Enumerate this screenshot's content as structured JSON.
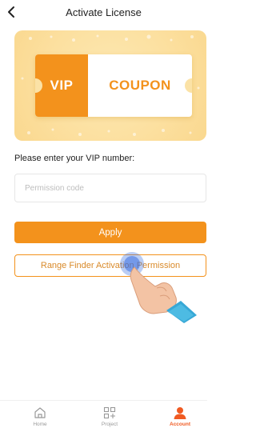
{
  "header": {
    "title": "Activate License"
  },
  "banner": {
    "vip": "VIP",
    "coupon": "COUPON"
  },
  "form": {
    "prompt": "Please enter your VIP number:",
    "placeholder": "Permission code",
    "value": ""
  },
  "buttons": {
    "apply": "Apply",
    "activation": "Range Finder Activation Permission"
  },
  "tabbar": {
    "items": [
      {
        "label": "Home",
        "icon": "home-icon",
        "active": false
      },
      {
        "label": "Project",
        "icon": "project-icon",
        "active": false
      },
      {
        "label": "Account",
        "icon": "account-icon",
        "active": true
      }
    ]
  },
  "colors": {
    "accent": "#f3921c",
    "active_tab": "#f05a22"
  }
}
